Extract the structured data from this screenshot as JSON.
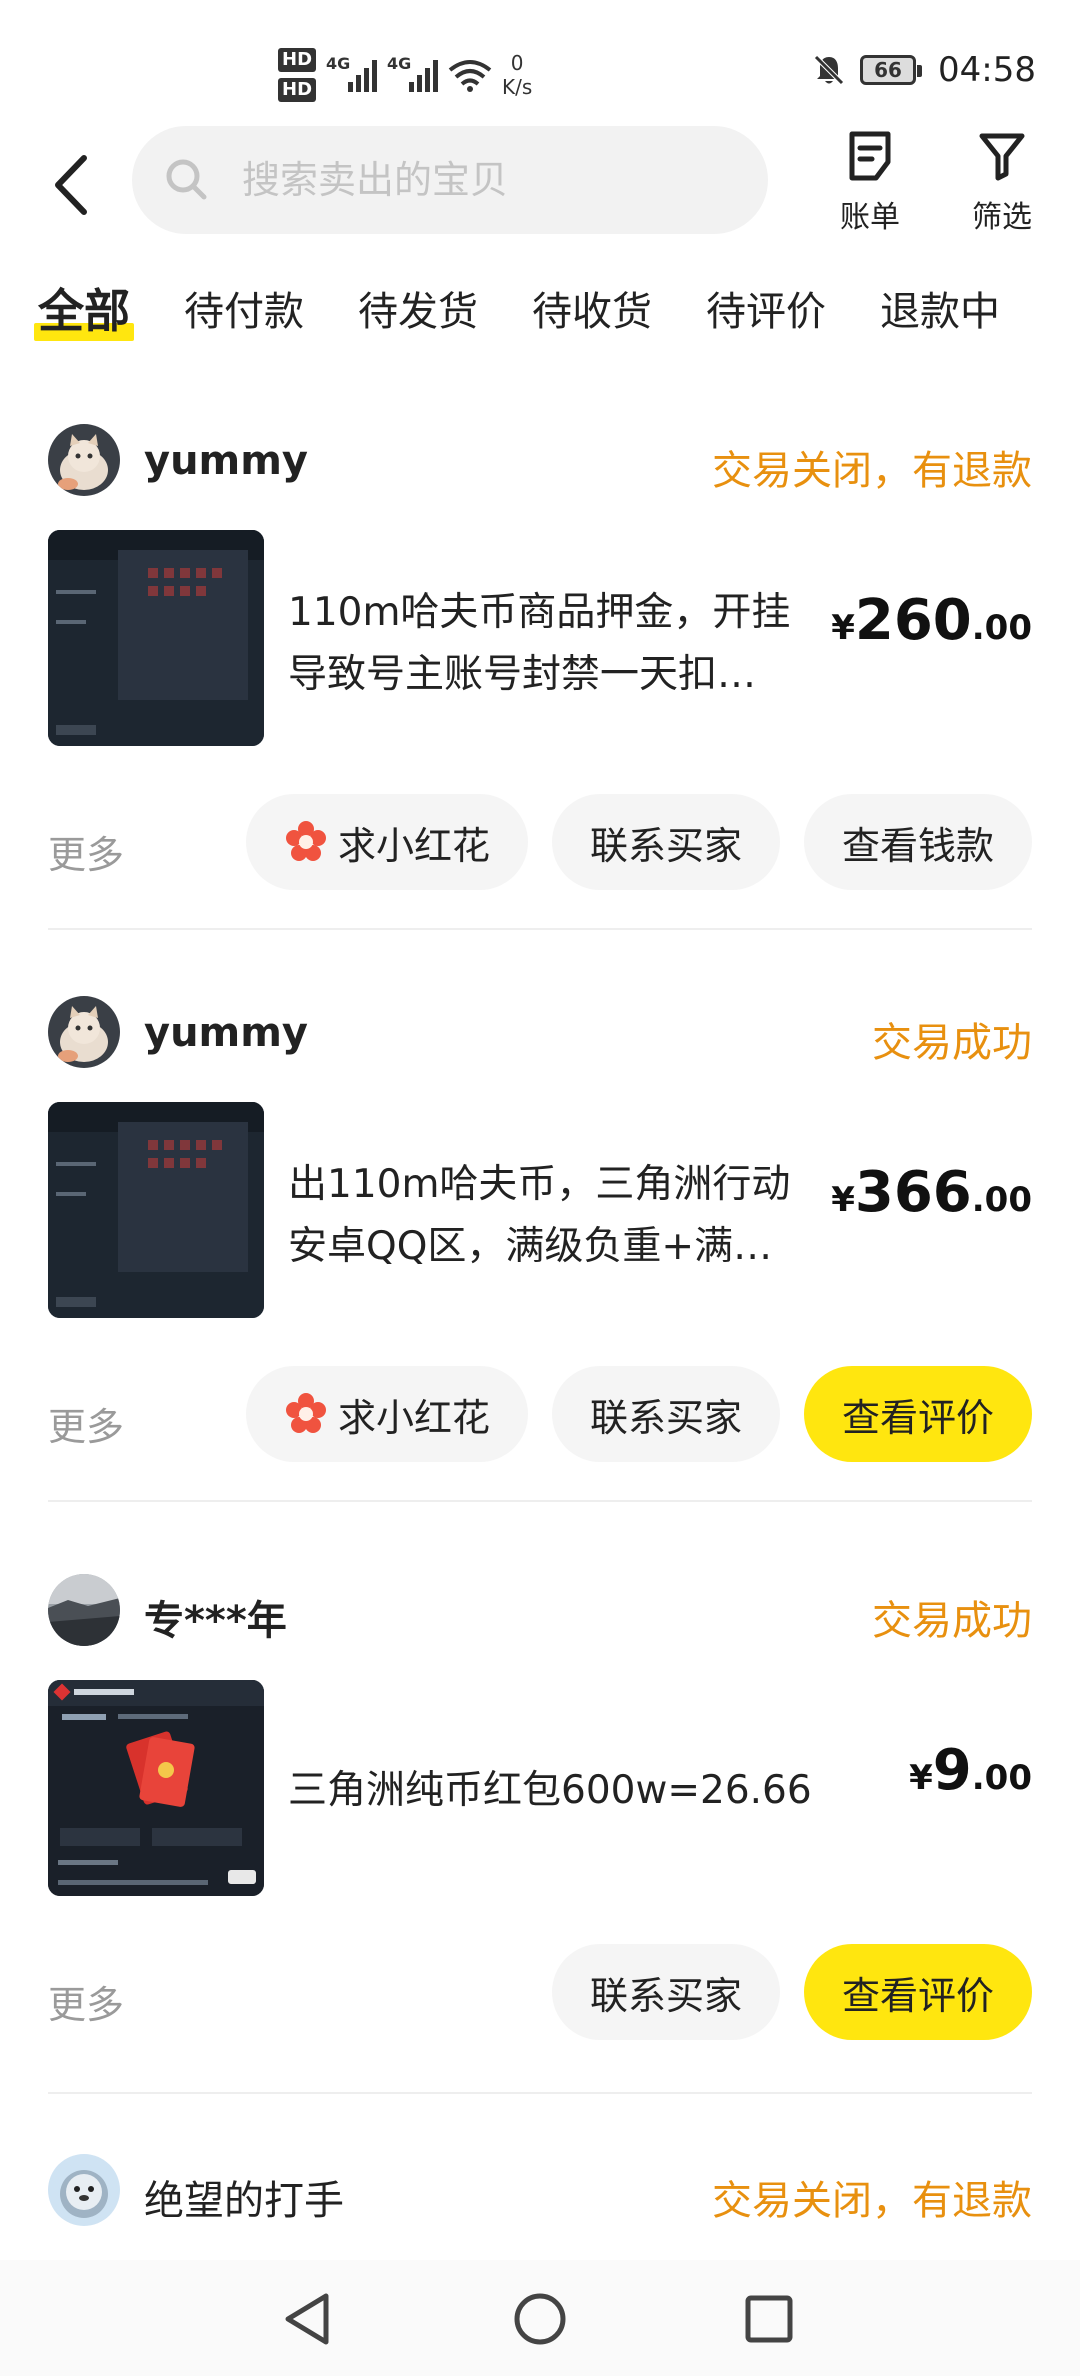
{
  "status_bar": {
    "hd1": "HD",
    "hd2": "HD",
    "net1": "4G",
    "net2": "4G",
    "speed_value": "0",
    "speed_unit": "K/s",
    "battery": "66",
    "time": "04:58"
  },
  "header": {
    "search_placeholder": "搜索卖出的宝贝",
    "bill_label": "账单",
    "filter_label": "筛选"
  },
  "tabs": [
    {
      "label": "全部",
      "active": true
    },
    {
      "label": "待付款"
    },
    {
      "label": "待发货"
    },
    {
      "label": "待收货"
    },
    {
      "label": "待评价"
    },
    {
      "label": "退款中"
    }
  ],
  "orders": [
    {
      "buyer": "yummy",
      "status": "交易关闭，有退款",
      "title_line1": "110m哈夫币商品押金，开挂",
      "title_line2": "导致号主账号封禁一天扣…",
      "price_currency": "¥",
      "price_int": "260",
      "price_dec": ".00",
      "more": "更多",
      "btn_flower": "求小红花",
      "btn_contact": "联系买家",
      "btn_primary": "查看钱款"
    },
    {
      "buyer": "yummy",
      "status": "交易成功",
      "title_line1": "出110m哈夫币，三角洲行动",
      "title_line2": "安卓QQ区，满级负重+满…",
      "price_currency": "¥",
      "price_int": "366",
      "price_dec": ".00",
      "more": "更多",
      "btn_flower": "求小红花",
      "btn_contact": "联系买家",
      "btn_primary": "查看评价"
    },
    {
      "buyer": "专***年",
      "status": "交易成功",
      "title_line1": "三角洲纯币红包600w=26.66",
      "price_currency": "¥",
      "price_int": "9",
      "price_dec": ".00",
      "more": "更多",
      "btn_contact": "联系买家",
      "btn_primary": "查看评价"
    },
    {
      "buyer": "绝望的打手",
      "status": "交易关闭，有退款"
    }
  ],
  "colors": {
    "accent_yellow": "#ffe60f",
    "status_orange": "#e8900f",
    "muted_gray": "#9a9a9a"
  },
  "icons": {
    "back": "back-arrow-icon",
    "search": "search-icon",
    "bill": "bill-icon",
    "filter": "filter-icon",
    "flower": "red-flower-icon"
  }
}
